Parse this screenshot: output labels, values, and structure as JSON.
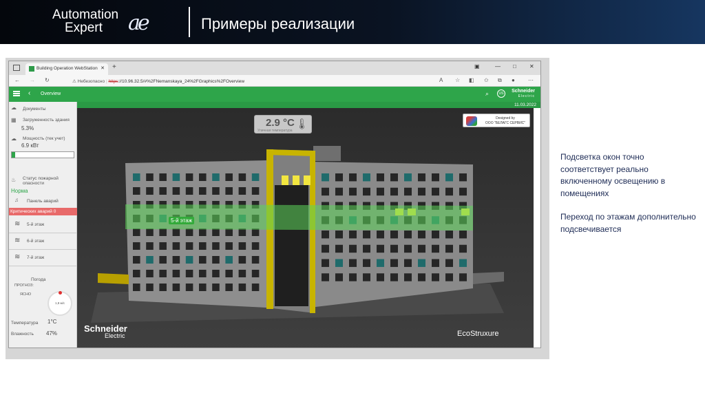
{
  "slide": {
    "logo_line1": "Automation",
    "logo_line2": "Expert",
    "logo_mark": "ae",
    "title": "Примеры реализации"
  },
  "browser": {
    "tab_title": "Building Operation WebStation",
    "tab_close": "✕",
    "new_tab": "+",
    "url_warning": "Небезопасно",
    "url_scheme": "https",
    "url_rest": "://10.96.32.5/#%2FNemanskaya_24%2FGraphics%2FOverview"
  },
  "app": {
    "overview_label": "Overview",
    "user_initials": "US",
    "brand_name": "Schneider",
    "brand_sub": "Electric",
    "date": "11.03.2022"
  },
  "sidebar": {
    "documents": "Документы",
    "load_label": "Загруженность здания",
    "load_value": "5.3%",
    "load_fraction": 0.053,
    "power_label": "Мощность (тек учет)",
    "power_value": "6.9 кВт",
    "fire_label": "Статус пожарной опасности",
    "fire_value": "Норма",
    "alarm_panel": "Панель аварий",
    "critical_alarms": "Критических аварий",
    "critical_count": "0",
    "floors": [
      "5-й этаж",
      "6-й этаж",
      "7-й этаж"
    ],
    "weather_label": "Погода",
    "forecast_label": "ПРОГНОЗ:",
    "forecast_value": "ЯСНО",
    "gauge_text": "1,8 м/с",
    "temp_label": "Температура",
    "temp_value": "1°C",
    "humidity_label": "Влажность",
    "humidity_value": "47%"
  },
  "viewer": {
    "outdoor_temp": "2.9 °C",
    "outdoor_temp_label": "Уличная температура",
    "designed_by": "Designed by",
    "designer": "ООО \"БЕЛАГС СЕРВИС\"",
    "floor_tag": "5-й этаж",
    "se_watermark": "Schneider",
    "se_watermark_sub": "Electric",
    "ecostruxure": "EcoStruxure"
  },
  "notes": {
    "p1": "Подсветка окон точно соответствует реально включенному освещению в помещениях",
    "p2": "Переход по этажам дополнительно подсвечивается"
  },
  "colors": {
    "app_green": "#2ea54a",
    "alarm_red": "#e86a6a",
    "note_text": "#1d2b55",
    "highlight_band": "#5dd65a",
    "lit_window": "#f2e640",
    "accent_yellow": "#c8b400"
  }
}
